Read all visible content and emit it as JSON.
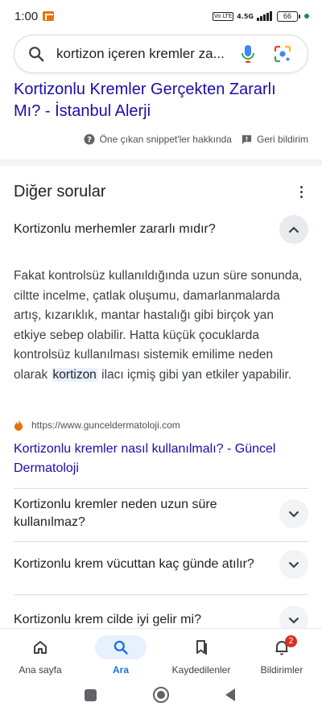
{
  "status_bar": {
    "time": "1:00",
    "volte": "Vo LTE",
    "network": "4.5G",
    "battery": "66"
  },
  "search": {
    "query": "kortizon içeren kremler za..."
  },
  "snippet": {
    "link_title": "Kortizonlu Kremler Gerçekten Zararlı Mı? - İstanbul Alerji",
    "about_label": "Öne çıkan snippet'ler hakkında",
    "feedback_label": "Geri bildirim"
  },
  "paa": {
    "title": "Diğer sorular",
    "expanded": {
      "question": "Kortizonlu merhemler zararlı mıdır?",
      "answer_before": "Fakat kontrolsüz kullanıldığında uzun süre sonunda, ciltte incelme, çatlak oluşumu, damarlanmalarda artış, kızarıklık, mantar hastalığı gibi birçok yan etkiye sebep olabilir. Hatta küçük çocuklarda kontrolsüz kullanılması sistemik emilime neden olarak ",
      "answer_highlight": "kortizon",
      "answer_after": " ilacı içmiş gibi yan etkiler yapabilir.",
      "source_url": "https://www.gunceldermatoloji.com",
      "source_title": "Kortizonlu kremler nasıl kullanılmalı? - Güncel Dermatoloji"
    },
    "questions": [
      "Kortizonlu kremler neden uzun süre kullanılmaz?",
      "Kortizonlu krem vücuttan kaç günde atılır?",
      "Kortizonlu krem cilde iyi gelir mi?"
    ]
  },
  "bottom_nav": {
    "items": [
      {
        "label": "Ana sayfa"
      },
      {
        "label": "Ara"
      },
      {
        "label": "Kaydedilenler"
      },
      {
        "label": "Bildirimler",
        "badge": "2"
      }
    ]
  },
  "colors": {
    "link": "#1a0dab",
    "accent": "#1a73e8",
    "badge": "#d93025",
    "source_favicon": "#e8710a"
  },
  "icons": {
    "search": "search-icon",
    "mic": "mic-icon",
    "lens": "lens-icon",
    "help": "help-circle-icon",
    "feedback": "feedback-icon",
    "more": "more-vert-icon",
    "chevron_up": "chevron-up-icon",
    "chevron_down": "chevron-down-icon",
    "home": "home-icon",
    "bookmark": "bookmark-icon",
    "bell": "bell-icon"
  }
}
